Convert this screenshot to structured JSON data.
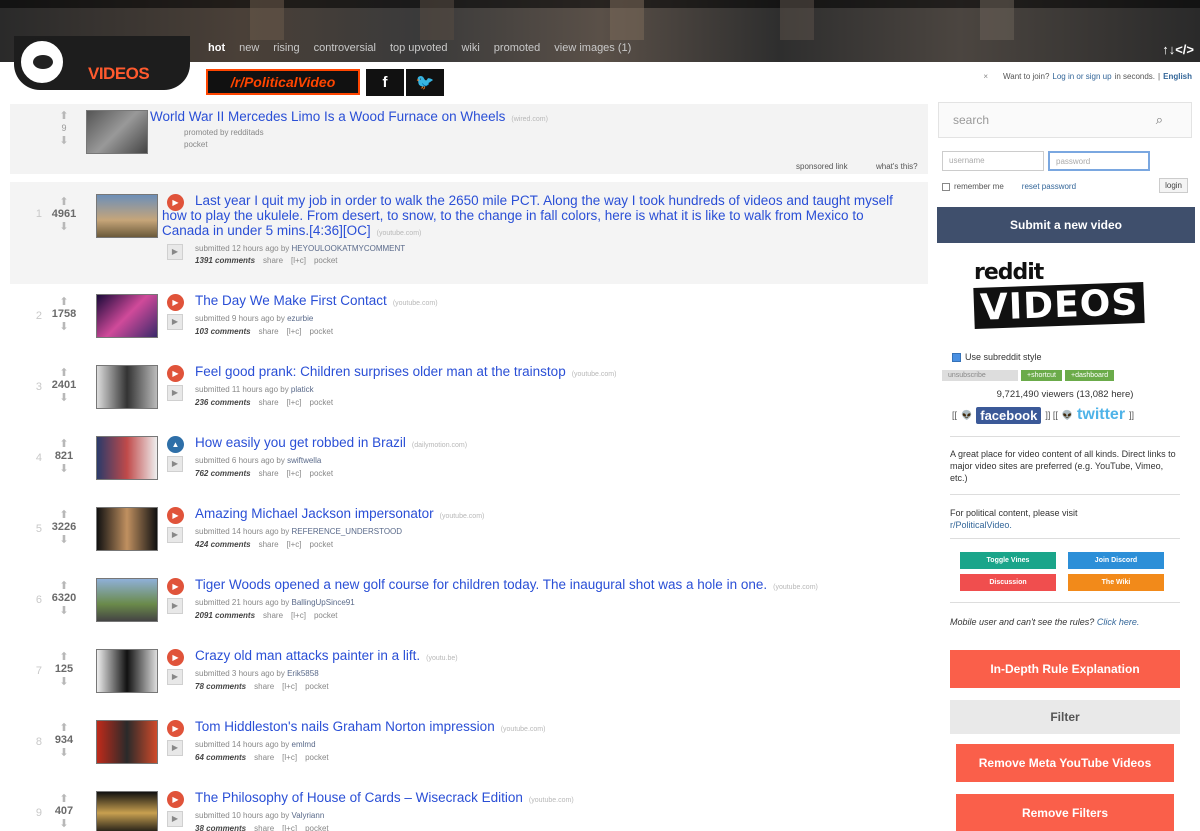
{
  "header": {
    "tabs": [
      {
        "label": "hot",
        "selected": true
      },
      {
        "label": "new",
        "selected": false
      },
      {
        "label": "rising",
        "selected": false
      },
      {
        "label": "controversial",
        "selected": false
      },
      {
        "label": "top upvoted",
        "selected": false
      },
      {
        "label": "wiki",
        "selected": false
      },
      {
        "label": "promoted",
        "selected": false
      },
      {
        "label": "view images (1)",
        "selected": false
      }
    ],
    "code_icon": "↑↓</>",
    "logo_text": "VIDEOS"
  },
  "badge": {
    "label": "/r/PoliticalVideo",
    "facebook": "f",
    "twitter": "🐦"
  },
  "join": {
    "close": "×",
    "text": "Want to join?",
    "login_link": "Log in or sign up",
    "suffix": "in seconds.",
    "language": "English"
  },
  "promoted_post": {
    "score": "9",
    "title": "World War II Mercedes Limo Is a Wood Furnace on Wheels",
    "domain": "(wired.com)",
    "promoted_by": "promoted by redditads",
    "pocket": "pocket",
    "sponsored": "sponsored link",
    "whats_this": "what's this?"
  },
  "posts": [
    {
      "rank": "1",
      "score": "4961",
      "title": "Last year I quit my job in order to walk the 2650 mile PCT. Along the way I took hundreds of videos and taught myself how to play the ukulele. From desert, to snow, to the change in fall colors, here is what it is like to walk from Mexico to Canada in under 5 mins.[4:36][OC]",
      "domain": "(youtube.com)",
      "meta": "submitted 12 hours ago by",
      "user": "HEYOULOOKATMYCOMMENT",
      "comments": "1391 comments"
    },
    {
      "rank": "2",
      "score": "1758",
      "title": "The Day We Make First Contact",
      "domain": "(youtube.com)",
      "meta": "submitted 9 hours ago by",
      "user": "ezurbie",
      "comments": "103 comments"
    },
    {
      "rank": "3",
      "score": "2401",
      "title": "Feel good prank: Children surprises older man at the trainstop",
      "domain": "(youtube.com)",
      "meta": "submitted 11 hours ago by",
      "user": "platick",
      "comments": "236 comments"
    },
    {
      "rank": "4",
      "score": "821",
      "title": "How easily you get robbed in Brazil",
      "domain": "(dailymotion.com)",
      "meta": "submitted 6 hours ago by",
      "user": "swiftwella",
      "comments": "762 comments"
    },
    {
      "rank": "5",
      "score": "3226",
      "title": "Amazing Michael Jackson impersonator",
      "domain": "(youtube.com)",
      "meta": "submitted 14 hours ago by",
      "user": "REFERENCE_UNDERSTOOD",
      "comments": "424 comments"
    },
    {
      "rank": "6",
      "score": "6320",
      "title": "Tiger Woods opened a new golf course for children today. The inaugural shot was a hole in one.",
      "domain": "(youtube.com)",
      "meta": "submitted 21 hours ago by",
      "user": "BallingUpSince91",
      "comments": "2091 comments"
    },
    {
      "rank": "7",
      "score": "125",
      "title": "Crazy old man attacks painter in a lift.",
      "domain": "(youtu.be)",
      "meta": "submitted 3 hours ago by",
      "user": "Erik5858",
      "comments": "78 comments"
    },
    {
      "rank": "8",
      "score": "934",
      "title": "Tom Hiddleston's nails Graham Norton impression",
      "domain": "(youtube.com)",
      "meta": "submitted 14 hours ago by",
      "user": "emlmd",
      "comments": "64 comments"
    },
    {
      "rank": "9",
      "score": "407",
      "title": "The Philosophy of House of Cards – Wisecrack Edition",
      "domain": "(youtube.com)",
      "meta": "submitted 10 hours ago by",
      "user": "Valyriann",
      "comments": "38 comments"
    }
  ],
  "post_actions": {
    "share": "share",
    "link": "[l+c]",
    "pocket": "pocket"
  },
  "sidebar": {
    "search_placeholder": "search",
    "username_placeholder": "username",
    "password_placeholder": "password",
    "remember": "remember me",
    "reset": "reset password",
    "login": "login",
    "submit": "Submit a new video",
    "logo_top": "reddit",
    "logo_big": "VIDEOS",
    "use_style": "Use subreddit style",
    "unsubscribe": "unsubscribe",
    "shortcut": "+shortcut",
    "dashboard": "+dashboard",
    "viewers": "9,721,490 viewers (13,082 here)",
    "facebook": "facebook",
    "twitter": "twitter",
    "desc1": "A great place for video content of all kinds. Direct links to major video sites are preferred (e.g. YouTube, Vimeo, etc.)",
    "desc2_text": "For political content, please visit",
    "desc2_link": "r/PoliticalVideo.",
    "btn_vines": "Toggle Vines",
    "btn_discord": "Join Discord",
    "btn_discussion": "Discussion",
    "btn_wiki": "The Wiki",
    "mobile_text": "Mobile user and can't see the rules?",
    "mobile_link": "Click here.",
    "rule_btn": "In-Depth Rule Explanation",
    "filter_label": "Filter",
    "remove_meta": "Remove Meta YouTube Videos",
    "remove_filters": "Remove Filters"
  },
  "colors": {
    "accent": "#ff4500",
    "link": "#2a4fd6",
    "submit_bg": "#3f4f6c",
    "rule_btn": "#fa5f4a"
  }
}
